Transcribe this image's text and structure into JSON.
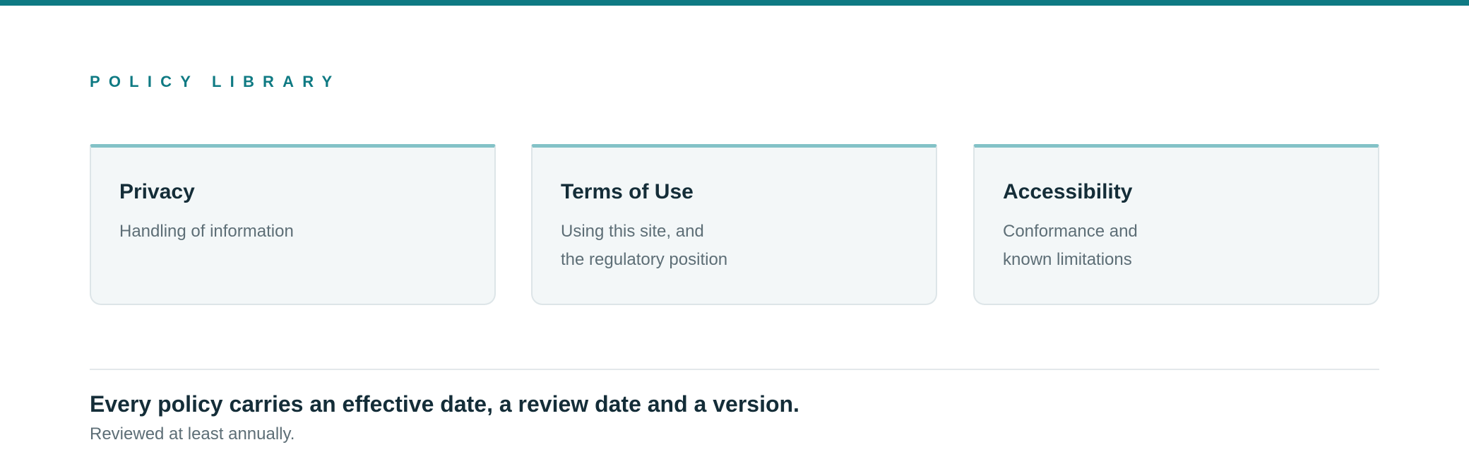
{
  "section": {
    "eyebrow": "POLICY LIBRARY"
  },
  "cards": [
    {
      "title": "Privacy",
      "description": "Handling of information"
    },
    {
      "title": "Terms of Use",
      "description": "Using this site, and\nthe regulatory position"
    },
    {
      "title": "Accessibility",
      "description": "Conformance and\nknown limitations"
    }
  ],
  "footer": {
    "headline": "Every policy carries an effective date, a review date and a version.",
    "subtext": "Reviewed at least annually."
  },
  "colors": {
    "accent": "#0f7a83",
    "card_top_border": "#83c2c7",
    "card_background": "#f3f7f8",
    "heading_text": "#142d38",
    "body_text": "#5d6e76"
  }
}
